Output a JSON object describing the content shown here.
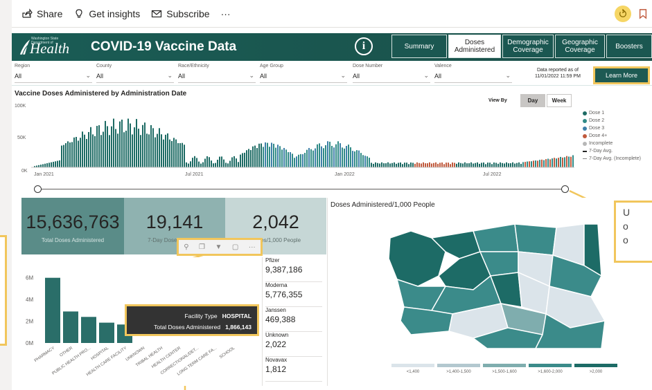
{
  "actionbar": {
    "share": "Share",
    "insights": "Get insights",
    "subscribe": "Subscribe",
    "more": "···"
  },
  "header": {
    "logo_small": "Washington State Department of",
    "logo_big": "Health",
    "title": "COVID-19 Vaccine Data",
    "info": "i",
    "tabs": [
      {
        "label": "Summary",
        "active": false
      },
      {
        "label": "Doses Administered",
        "active": true
      },
      {
        "label": "Demographic Coverage",
        "active": false
      },
      {
        "label": "Geographic Coverage",
        "active": false
      },
      {
        "label": "Boosters",
        "active": false
      }
    ]
  },
  "slicers": [
    {
      "label": "Region",
      "value": "All"
    },
    {
      "label": "County",
      "value": "All"
    },
    {
      "label": "Race/Ethnicity",
      "value": "All"
    },
    {
      "label": "Age Group",
      "value": "All"
    },
    {
      "label": "Dose Number",
      "value": "All"
    },
    {
      "label": "Valence",
      "value": "All"
    }
  ],
  "reported": {
    "line1": "Data reported as of",
    "line2": "11/01/2022 11:59 PM"
  },
  "learn_more": "Learn More",
  "timeline": {
    "title": "Vaccine Doses Administered by Administration Date",
    "view_by": "View By",
    "day": "Day",
    "week": "Week",
    "y_ticks": [
      "100K",
      "50K",
      "0K"
    ],
    "x_ticks": [
      "Jan 2021",
      "Jul 2021",
      "Jan 2022",
      "Jul 2022"
    ],
    "legend": [
      {
        "label": "Dose 1",
        "color": "#1d6b64"
      },
      {
        "label": "Dose 2",
        "color": "#2f8a86"
      },
      {
        "label": "Dose 3",
        "color": "#3d7fa8"
      },
      {
        "label": "Dose 4+",
        "color": "#c0593c"
      },
      {
        "label": "Incomplete",
        "color": "#b7b7b7"
      },
      {
        "label": "7-Day Avg.",
        "color": "#252423"
      },
      {
        "label": "7-Day Avg. (Incomplete)",
        "color": "#888888"
      }
    ]
  },
  "kpis": [
    {
      "value": "15,636,763",
      "caption": "Total Doses Administered"
    },
    {
      "value": "19,141",
      "caption": "7-Day Doses Average"
    },
    {
      "value": "2,042",
      "caption": "Doses/1,000 People"
    }
  ],
  "facility_chart": {
    "y_ticks": [
      "6M",
      "4M",
      "2M",
      "0M"
    ],
    "categories": [
      "PHARMACY",
      "OTHER",
      "PUBLIC HEALTH PRO...",
      "HOSPITAL",
      "HEALTH CARE FACILITY",
      "UNKNOWN",
      "TRIBAL HEALTH",
      "HEALTH CENTER",
      "CORRECTIONAL/DET...",
      "LONG TERM CARE FA...",
      "SCHOOL"
    ]
  },
  "chart_data": {
    "type": "bar",
    "categories": [
      "PHARMACY",
      "OTHER",
      "PUBLIC HEALTH PRO...",
      "HOSPITAL",
      "HEALTH CARE FACILITY"
    ],
    "values": [
      6.0,
      2.9,
      2.4,
      1.87,
      1.7
    ],
    "ylabel": "",
    "ylim": [
      0,
      7
    ],
    "units": "M"
  },
  "manufacturers": [
    {
      "name": "Pfizer",
      "value": "9,387,186"
    },
    {
      "name": "Moderna",
      "value": "5,776,355"
    },
    {
      "name": "Janssen",
      "value": "469,388"
    },
    {
      "name": "Unknown",
      "value": "2,022"
    },
    {
      "name": "Novavax",
      "value": "1,812"
    }
  ],
  "tooltip": {
    "k1": "Facility Type",
    "v1": "HOSPITAL",
    "k2": "Total Doses Administered",
    "v2": "1,866,143"
  },
  "map": {
    "title": "Doses Administered/1,000 People",
    "legend": [
      {
        "label": "<1,400",
        "color": "#dbe4ea"
      },
      {
        "label": ">1,400-1,500",
        "color": "#b3c8cf"
      },
      {
        "label": ">1,500-1,600",
        "color": "#7fadae"
      },
      {
        "label": ">1,600-2,000",
        "color": "#3b8b8a"
      },
      {
        "label": ">2,000",
        "color": "#1d6b66"
      }
    ]
  },
  "callout_text": [
    "U",
    "o",
    "o"
  ]
}
